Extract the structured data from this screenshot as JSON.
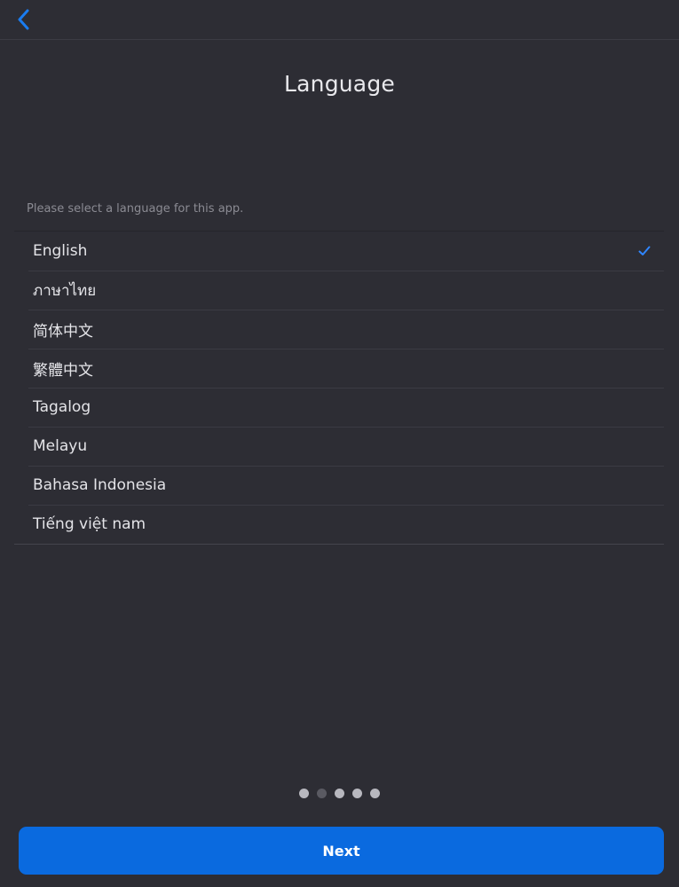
{
  "header": {
    "back_icon": "chevron-left-icon"
  },
  "title": "Language",
  "instruction": "Please select a language for this app.",
  "languages": [
    {
      "label": "English",
      "selected": true
    },
    {
      "label": "ภาษาไทย",
      "selected": false
    },
    {
      "label": "简体中文",
      "selected": false
    },
    {
      "label": "繁體中文",
      "selected": false
    },
    {
      "label": "Tagalog",
      "selected": false
    },
    {
      "label": "Melayu",
      "selected": false
    },
    {
      "label": "Bahasa Indonesia",
      "selected": false
    },
    {
      "label": "Tiếng việt nam",
      "selected": false
    }
  ],
  "selection_icon": "checkmark-icon",
  "pagination": {
    "total": 5,
    "current": 2
  },
  "next_button": {
    "label": "Next"
  },
  "colors": {
    "background": "#2d2d34",
    "accent": "#0a6adf",
    "check": "#2f86ff"
  }
}
